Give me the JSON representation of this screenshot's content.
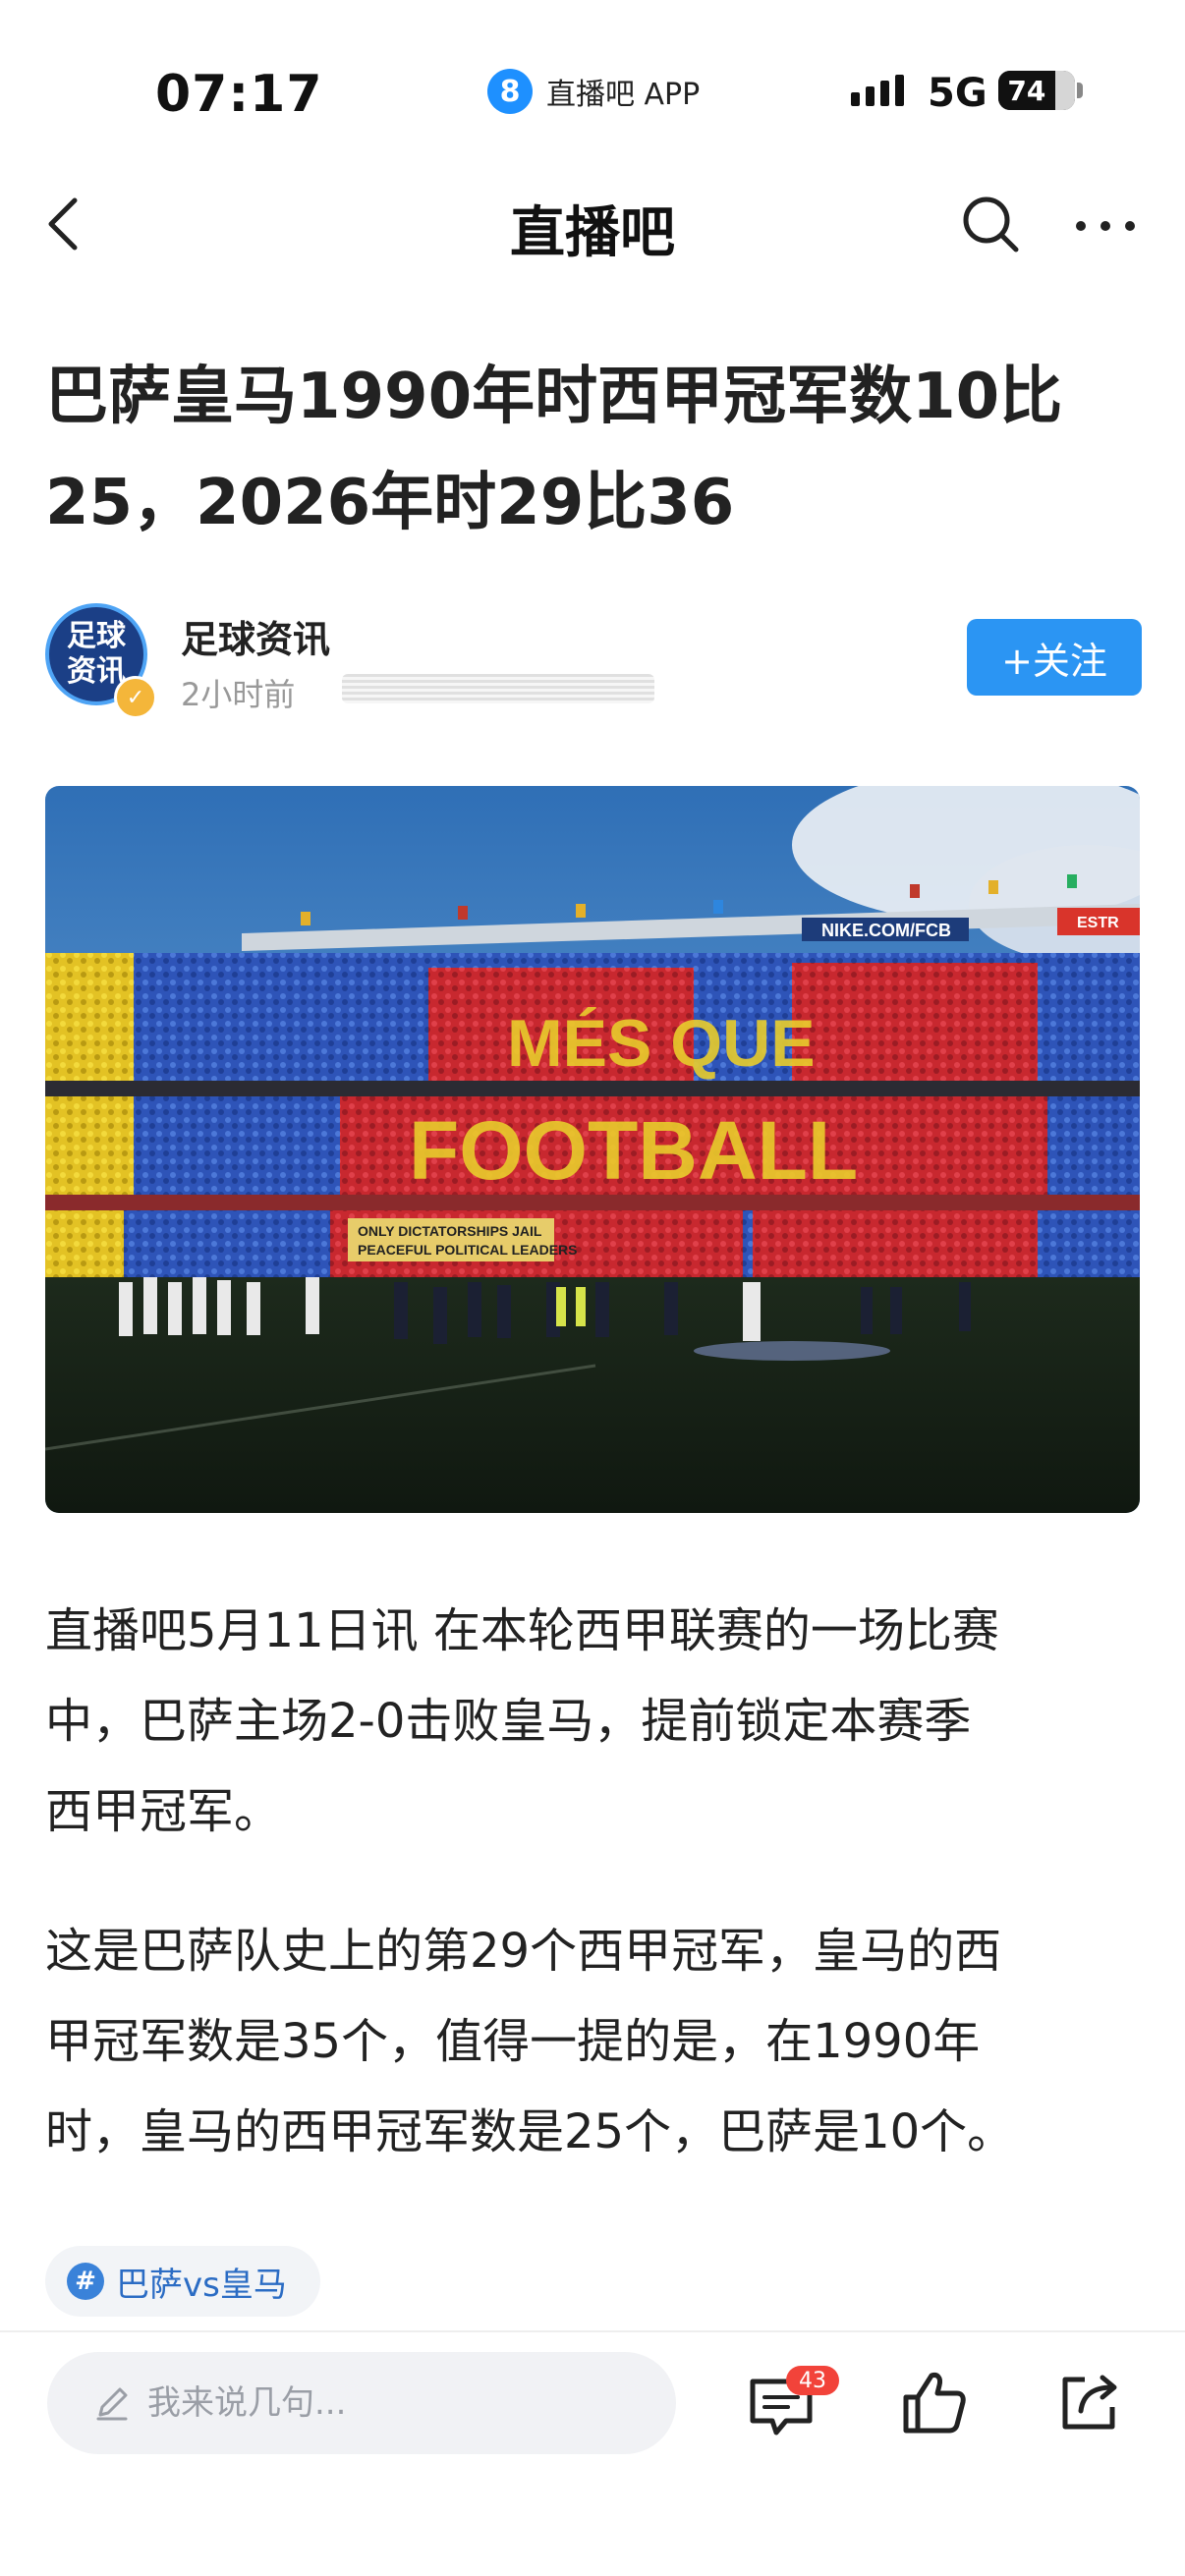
{
  "status_bar": {
    "time": "07:17",
    "app_icon_text": "8",
    "app_name": "直播吧 APP",
    "network": "5G",
    "battery": "74"
  },
  "nav": {
    "title": "直播吧"
  },
  "article": {
    "headline_lines": [
      "巴萨皇马1990年时西甲冠军数10比",
      "25，2026年时29比36"
    ],
    "author": {
      "avatar_text_line1": "足球",
      "avatar_text_line2": "资讯",
      "name": "足球资讯",
      "time": "2小时前",
      "follow_label": "+关注"
    },
    "photo": {
      "banner_text": "NIKE.COM/FCB",
      "ad_text": "ESTR",
      "tifo_text_top": "MÉS QUE",
      "tifo_text_bottom": "FOOTBALL",
      "sign_line1": "ONLY DICTATORSHIPS JAIL",
      "sign_line2": "PEACEFUL POLITICAL LEADERS"
    },
    "paragraphs": [
      {
        "lines": [
          "直播吧5月11日讯  在本轮西甲联赛的一场比赛",
          "中，巴萨主场2-0击败皇马，提前锁定本赛季",
          "西甲冠军。"
        ]
      },
      {
        "lines": [
          "这是巴萨队史上的第29个西甲冠军，皇马的西",
          "甲冠军数是35个，值得一提的是，在1990年",
          "时，皇马的西甲冠军数是25个，巴萨是10个。"
        ]
      }
    ],
    "topic": {
      "hash": "#",
      "label": "巴萨vs皇马"
    }
  },
  "bottom_bar": {
    "comment_placeholder": "我来说几句...",
    "comment_count": "43"
  }
}
